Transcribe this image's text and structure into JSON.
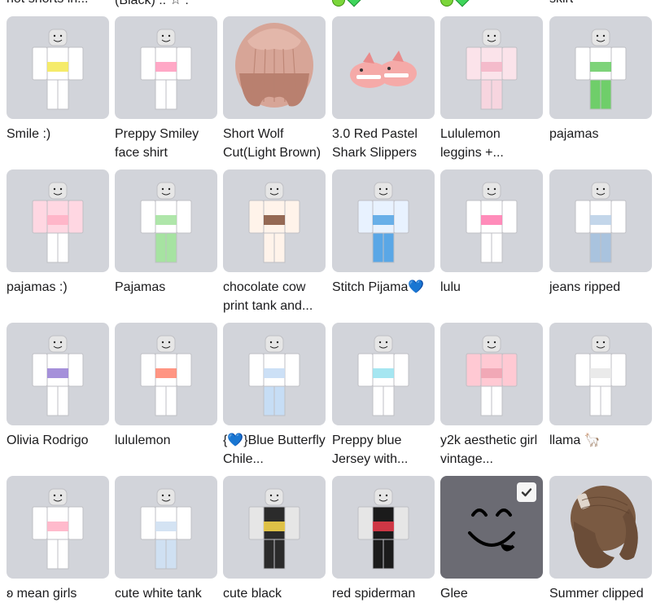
{
  "top_row": [
    {
      "name": "hot shorts in..."
    },
    {
      "name": "(Black) :: ☆ :"
    },
    {
      "name": ""
    },
    {
      "name": ""
    },
    {
      "name": ""
    },
    {
      "name": "skirt"
    }
  ],
  "items": [
    {
      "name": "Smile :)",
      "type": "shirt",
      "top": "#ffffff",
      "accent": "#f4e95a",
      "pants": "#ffffff"
    },
    {
      "name": "Preppy Smiley face shirt",
      "type": "shirt",
      "top": "#ffffff",
      "accent": "#ff9fc0",
      "pants": "#ffffff"
    },
    {
      "name": "Short Wolf Cut(Light Brown)",
      "type": "hair-wolf",
      "top": "#d7a597",
      "accent": "#b9806f",
      "pants": "#d7a597"
    },
    {
      "name": "3.0 Red Pastel Shark Slippers",
      "type": "slippers",
      "top": "#f5aaa8",
      "accent": "#e98b8b",
      "pants": "#ffffff"
    },
    {
      "name": "Lululemon leggins +...",
      "type": "outfit",
      "top": "#fbe3ea",
      "accent": "#f3b6c8",
      "pants": "#f7d5df"
    },
    {
      "name": "pajamas",
      "type": "outfit",
      "top": "#ffffff",
      "accent": "#6fce6a",
      "pants": "#6fce6a"
    },
    {
      "name": "pajamas :)",
      "type": "outfit",
      "top": "#ffd7e2",
      "accent": "#ffb3c6",
      "pants": "#ffffff"
    },
    {
      "name": "Pajamas",
      "type": "outfit",
      "top": "#ffffff",
      "accent": "#a6e3a1",
      "pants": "#a6e3a1"
    },
    {
      "name": "chocolate cow print tank and...",
      "type": "outfit",
      "top": "#fff3ea",
      "accent": "#8a5a44",
      "pants": "#fff3ea"
    },
    {
      "name": "Stitch Pijama💙",
      "type": "outfit",
      "top": "#e8f2ff",
      "accent": "#5aa7e6",
      "pants": "#5aa7e6"
    },
    {
      "name": "lulu",
      "type": "outfit",
      "top": "#ffffff",
      "accent": "#ff7fb2",
      "pants": "#ffffff"
    },
    {
      "name": "jeans ripped",
      "type": "outfit",
      "top": "#ffffff",
      "accent": "#bcd2e8",
      "pants": "#a9c3de"
    },
    {
      "name": "Olivia Rodrigo",
      "type": "outfit",
      "top": "#ffffff",
      "accent": "#9b84d6",
      "pants": "#ffffff"
    },
    {
      "name": "lululemon",
      "type": "outfit",
      "top": "#ffffff",
      "accent": "#ff8a75",
      "pants": "#ffffff"
    },
    {
      "name": "{💙}Blue Butterfly Chile...",
      "type": "outfit",
      "top": "#ffffff",
      "accent": "#c6ddf5",
      "pants": "#c6ddf5"
    },
    {
      "name": "Preppy blue Jersey with...",
      "type": "outfit",
      "top": "#ffffff",
      "accent": "#9be3ef",
      "pants": "#ffffff"
    },
    {
      "name": "y2k aesthetic girl vintage...",
      "type": "outfit",
      "top": "#ffc9d3",
      "accent": "#f0a4b3",
      "pants": "#ffffff"
    },
    {
      "name": "llama 🦙",
      "type": "outfit",
      "top": "#ffffff",
      "accent": "#e8e8e8",
      "pants": "#ffffff"
    },
    {
      "name": "ʚ mean girls",
      "type": "outfit",
      "top": "#ffffff",
      "accent": "#ffb3c6",
      "pants": "#ffffff"
    },
    {
      "name": "cute white tank",
      "type": "outfit",
      "top": "#ffffff",
      "accent": "#cfe0f2",
      "pants": "#cfe0f2"
    },
    {
      "name": "cute black",
      "type": "outfit",
      "top": "#2b2b2b",
      "accent": "#f2d24a",
      "pants": "#2b2b2b"
    },
    {
      "name": "red spiderman",
      "type": "outfit",
      "top": "#1b1b1b",
      "accent": "#e23b4a",
      "pants": "#1b1b1b"
    },
    {
      "name": "Glee",
      "type": "face",
      "top": "#000000",
      "accent": "#000000",
      "pants": "#000000",
      "equipped": true
    },
    {
      "name": "Summer clipped",
      "type": "hair-clip",
      "top": "#7a5a42",
      "accent": "#e0d6cc",
      "pants": "#7a5a42"
    }
  ],
  "colors": {
    "card_bg": "#d2d4da",
    "card_dark": "#6b6b73",
    "text": "#1b1b1d",
    "skin": "#e6e6e6"
  }
}
